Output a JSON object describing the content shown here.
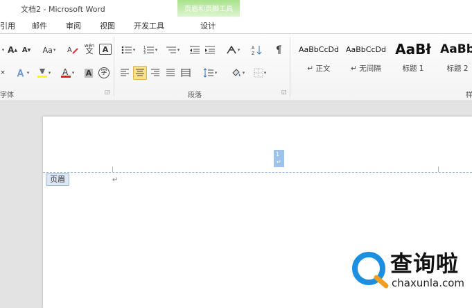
{
  "window": {
    "title": "文档2 - Microsoft Word"
  },
  "contextual_group": {
    "title": "页眉和页脚工具"
  },
  "tabs": [
    "引用",
    "邮件",
    "审阅",
    "视图",
    "开发工具",
    "设计"
  ],
  "ribbon": {
    "font_group_label": "字体",
    "paragraph_group_label": "段落",
    "styles_group_label": "样式",
    "change_case_label": "Aa",
    "enclosed_char_label": "字",
    "phonetic_label": "wén",
    "styles": [
      {
        "sample": "AaBbCcDd",
        "name": "↵ 正文"
      },
      {
        "sample": "AaBbCcDd",
        "name": "↵ 无间隔"
      },
      {
        "sample": "AaBł",
        "name": "标题 1"
      },
      {
        "sample": "AaBb",
        "name": "标题 2"
      }
    ],
    "accent_colors": {
      "highlight": "#ffff00",
      "font_color": "#e02020",
      "active": "#fbe08a"
    }
  },
  "document": {
    "header_tag": "页眉",
    "page_number_field": "1"
  },
  "watermark": {
    "brand": "查询啦",
    "url": "chaxunla.com"
  }
}
